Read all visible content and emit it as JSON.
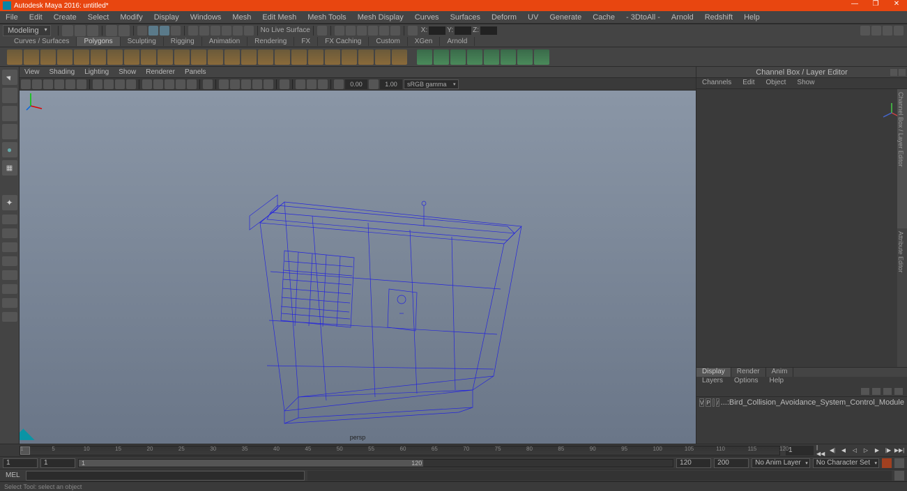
{
  "title": "Autodesk Maya 2016: untitled*",
  "menubar": [
    "File",
    "Edit",
    "Create",
    "Select",
    "Modify",
    "Display",
    "Windows",
    "Mesh",
    "Edit Mesh",
    "Mesh Tools",
    "Mesh Display",
    "Curves",
    "Surfaces",
    "Deform",
    "UV",
    "Generate",
    "Cache",
    "- 3DtoAll -",
    "Arnold",
    "Redshift",
    "Help"
  ],
  "workspace_dropdown": "Modeling",
  "no_live_surface": "No Live Surface",
  "coords": {
    "x_label": "X:",
    "y_label": "Y:",
    "z_label": "Z:"
  },
  "shelftabs": [
    "Curves / Surfaces",
    "Polygons",
    "Sculpting",
    "Rigging",
    "Animation",
    "Rendering",
    "FX",
    "FX Caching",
    "Custom",
    "XGen",
    "Arnold"
  ],
  "shelftabs_active": 1,
  "viewmenu": [
    "View",
    "Shading",
    "Lighting",
    "Show",
    "Renderer",
    "Panels"
  ],
  "viewnums": {
    "a": "0.00",
    "b": "1.00"
  },
  "colorspace": "sRGB gamma",
  "camera_label": "persp",
  "channelbox": {
    "title": "Channel Box / Layer Editor",
    "tabs": [
      "Channels",
      "Edit",
      "Object",
      "Show"
    ],
    "vertical_tabs": [
      "Channel Box / Layer Editor",
      "Attribute Editor"
    ]
  },
  "display_tabs": [
    "Display",
    "Render",
    "Anim"
  ],
  "layer_menu": [
    "Layers",
    "Options",
    "Help"
  ],
  "layer_row": {
    "v": "V",
    "p": "P",
    "slash": "/",
    "name": "...:Bird_Collision_Avoidance_System_Control_Module"
  },
  "time": {
    "ticks": [
      "1",
      "5",
      "10",
      "15",
      "20",
      "25",
      "30",
      "35",
      "40",
      "45",
      "50",
      "55",
      "60",
      "65",
      "70",
      "75",
      "80",
      "85",
      "90",
      "95",
      "100",
      "105",
      "110",
      "115",
      "120"
    ],
    "current": "1"
  },
  "range": {
    "start_outer": "1",
    "start": "1",
    "end": "120",
    "end_outer": "120",
    "end2": "200"
  },
  "anim_layer": "No Anim Layer",
  "char_set": "No Character Set",
  "cmd_lang": "MEL",
  "help_text": "Select Tool: select an object"
}
